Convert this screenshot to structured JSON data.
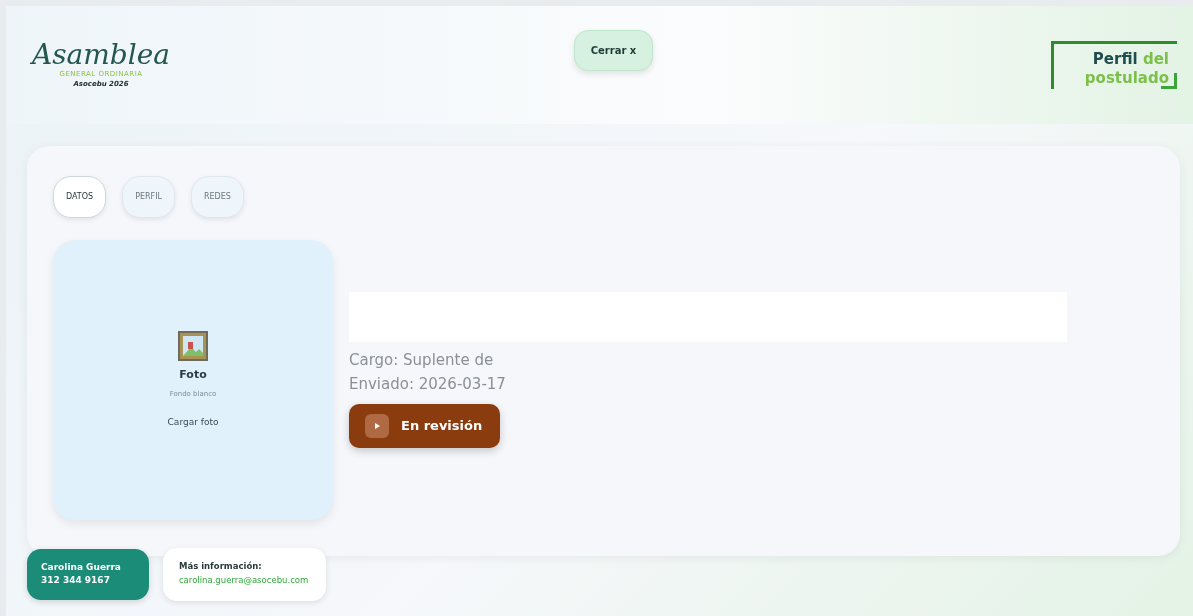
{
  "header": {
    "logo": {
      "script": "Asamblea",
      "line1": "GENERAL ORDINARIA",
      "line2": "Asocebu 2026"
    },
    "close_button": {
      "label": "Cerrar",
      "icon": "x"
    },
    "title": {
      "main": "Perfil",
      "accent": "del postulado"
    }
  },
  "tabs": [
    {
      "label": "DATOS",
      "selected": true
    },
    {
      "label": "PERFIL",
      "selected": false
    },
    {
      "label": "REDES",
      "selected": false
    }
  ],
  "photo_card": {
    "title": "Foto",
    "hint": "Fondo blanco",
    "action": "Cargar foto"
  },
  "details": {
    "cargo": "Cargo: Suplente de",
    "enviado": "Enviado: 2026-03-17",
    "status": "En revisión"
  },
  "footer": {
    "name": "Carolina Guerra",
    "phone": "312 344 9167",
    "info_label": "Más información:",
    "email": "carolina.guerra@asocebu.com"
  }
}
